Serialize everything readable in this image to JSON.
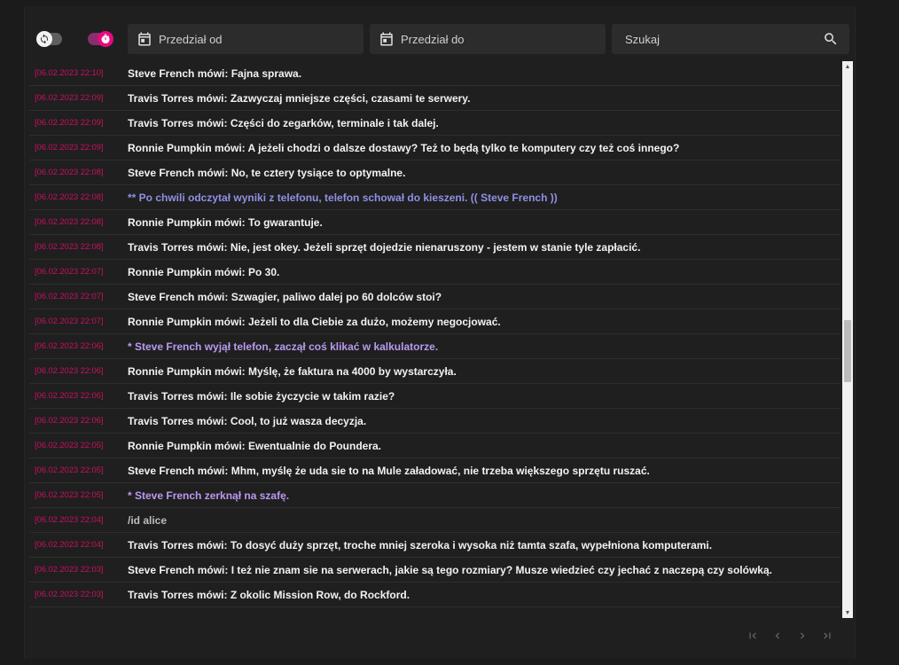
{
  "toolbar": {
    "sync_toggle_icon": "sync-icon",
    "timer_toggle_icon": "stopwatch-icon",
    "date_from_placeholder": "Przedział od",
    "date_to_placeholder": "Przedział do",
    "search_placeholder": "Szukaj",
    "accent_color": "#e6097e"
  },
  "log": {
    "colors": {
      "timestamp": "#c8105f",
      "say": "#f2f2f2",
      "me": "#b99af0",
      "do": "#8f8fe6",
      "cmd": "#bdbdbd"
    },
    "rows": [
      {
        "time": "[06.02.2023 22:10]",
        "text": "Steve French mówi: Fajna sprawa.",
        "kind": "say"
      },
      {
        "time": "[06.02.2023 22:09]",
        "text": "Travis Torres mówi: Zazwyczaj mniejsze części, czasami te serwery.",
        "kind": "say"
      },
      {
        "time": "[06.02.2023 22:09]",
        "text": "Travis Torres mówi: Części do zegarków, terminale i tak dalej.",
        "kind": "say"
      },
      {
        "time": "[06.02.2023 22:09]",
        "text": "Ronnie Pumpkin mówi: A jeżeli chodzi o dalsze dostawy? Też to będą tylko te komputery czy też coś innego?",
        "kind": "say"
      },
      {
        "time": "[06.02.2023 22:08]",
        "text": "Steve French mówi: No, te cztery tysiące to optymalne.",
        "kind": "say"
      },
      {
        "time": "[06.02.2023 22:08]",
        "text": "** Po chwili odczytał wyniki z telefonu, telefon schował do kieszeni. (( Steve French ))",
        "kind": "do"
      },
      {
        "time": "[06.02.2023 22:08]",
        "text": "Ronnie Pumpkin mówi: To gwarantuje.",
        "kind": "say"
      },
      {
        "time": "[06.02.2023 22:08]",
        "text": "Travis Torres mówi: Nie, jest okey. Jeżeli sprzęt dojedzie nienaruszony - jestem w stanie tyle zapłacić.",
        "kind": "say"
      },
      {
        "time": "[06.02.2023 22:07]",
        "text": "Ronnie Pumpkin mówi: Po 30.",
        "kind": "say"
      },
      {
        "time": "[06.02.2023 22:07]",
        "text": "Steve French mówi: Szwagier, paliwo dalej po 60 dolców stoi?",
        "kind": "say"
      },
      {
        "time": "[06.02.2023 22:07]",
        "text": "Ronnie Pumpkin mówi: Jeżeli to dla Ciebie za dużo, możemy negocjować.",
        "kind": "say"
      },
      {
        "time": "[06.02.2023 22:06]",
        "text": "* Steve French wyjął telefon, zaczął coś klikać w kalkulatorze.",
        "kind": "me"
      },
      {
        "time": "[06.02.2023 22:06]",
        "text": "Ronnie Pumpkin mówi: Myślę, że faktura na 4000 by wystarczyła.",
        "kind": "say"
      },
      {
        "time": "[06.02.2023 22:06]",
        "text": "Travis Torres mówi: Ile sobie życzycie w takim razie?",
        "kind": "say"
      },
      {
        "time": "[06.02.2023 22:06]",
        "text": "Travis Torres mówi: Cool, to już wasza decyzja.",
        "kind": "say"
      },
      {
        "time": "[06.02.2023 22:05]",
        "text": "Ronnie Pumpkin mówi: Ewentualnie do Poundera.",
        "kind": "say"
      },
      {
        "time": "[06.02.2023 22:05]",
        "text": "Steve French mówi: Mhm, myślę że uda sie to na Mule załadować, nie trzeba większego sprzętu ruszać.",
        "kind": "say"
      },
      {
        "time": "[06.02.2023 22:05]",
        "text": "* Steve French zerknął na szafę.",
        "kind": "me"
      },
      {
        "time": "[06.02.2023 22:04]",
        "text": "/id alice",
        "kind": "cmd"
      },
      {
        "time": "[06.02.2023 22:04]",
        "text": "Travis Torres mówi: To dosyć duży sprzęt, troche mniej szeroka i wysoka niż tamta szafa, wypełniona komputerami.",
        "kind": "say"
      },
      {
        "time": "[06.02.2023 22:03]",
        "text": "Steve French mówi: I też nie znam sie na serwerach, jakie są tego rozmiary? Musze wiedzieć czy jechać z naczepą czy solówką.",
        "kind": "say"
      },
      {
        "time": "[06.02.2023 22:03]",
        "text": "Travis Torres mówi: Z okolic Mission Row, do Rockford.",
        "kind": "say"
      }
    ]
  },
  "pager": {
    "first_icon": "first-page-icon",
    "prev_icon": "chevron-left-icon",
    "next_icon": "chevron-right-icon",
    "last_icon": "last-page-icon"
  }
}
